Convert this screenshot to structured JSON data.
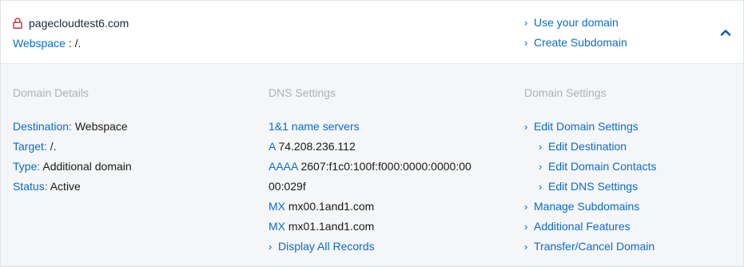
{
  "header": {
    "domain": "pagecloudtest6.com",
    "webspace_label": "Webspace",
    "webspace_sep": " : ",
    "webspace_value": "/.",
    "links": [
      "Use your domain",
      "Create Subdomain"
    ]
  },
  "domain_details": {
    "title": "Domain Details",
    "rows": [
      {
        "label": "Destination:",
        "value": " Webspace"
      },
      {
        "label": "Target:",
        "value": " /."
      },
      {
        "label": "Type:",
        "value": " Additional domain"
      },
      {
        "label": "Status:",
        "value": " Active"
      }
    ]
  },
  "dns_settings": {
    "title": "DNS Settings",
    "name_servers": "1&1 name servers",
    "a_label": "A",
    "a_value": " 74.208.236.112",
    "aaaa_label": "AAAA",
    "aaaa_value_1": " 2607:f1c0:100f:f000:0000:0000:00",
    "aaaa_value_2": "00:029f",
    "mx_label": "MX",
    "mx_values": [
      " mx00.1and1.com",
      " mx01.1and1.com"
    ],
    "display_all": "Display All Records"
  },
  "domain_settings": {
    "title": "Domain Settings",
    "items": [
      {
        "label": "Edit Domain Settings",
        "indent": false
      },
      {
        "label": "Edit Destination",
        "indent": true
      },
      {
        "label": "Edit Domain Contacts",
        "indent": true
      },
      {
        "label": "Edit DNS Settings",
        "indent": true
      },
      {
        "label": "Manage Subdomains",
        "indent": false
      },
      {
        "label": "Additional Features",
        "indent": false
      },
      {
        "label": "Transfer/Cancel Domain",
        "indent": false
      }
    ]
  },
  "colors": {
    "link": "#0b6bcb",
    "lock": "#d0303a",
    "muted_title": "#a9b3bb",
    "body_bg": "#f4f6f7"
  },
  "icons": {
    "lock": "lock-icon",
    "chevron_right": "chevron-right-icon",
    "collapse": "chevron-up-icon"
  }
}
